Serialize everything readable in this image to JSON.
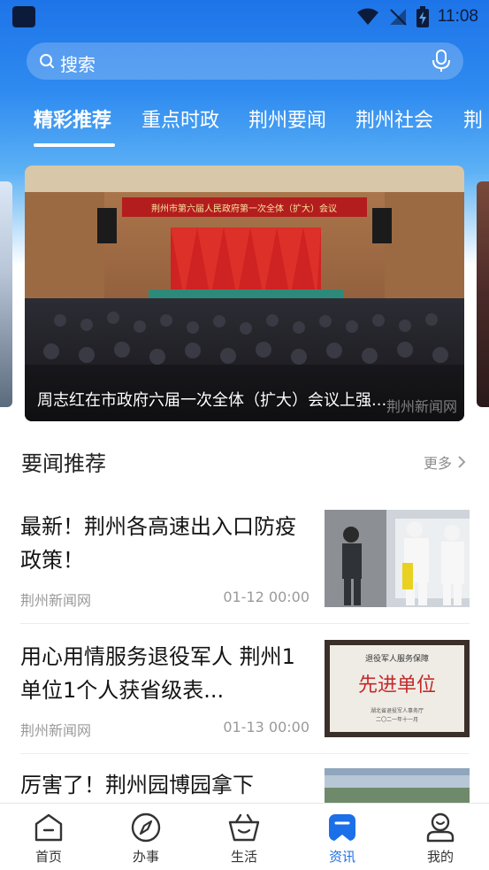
{
  "status_bar": {
    "time": "11:08"
  },
  "search": {
    "placeholder": "搜索"
  },
  "tabs": [
    {
      "label": "精彩推荐",
      "active": true
    },
    {
      "label": "重点时政"
    },
    {
      "label": "荆州要闻"
    },
    {
      "label": "荆州社会"
    },
    {
      "label": "荆"
    }
  ],
  "banner": {
    "headline": "荆州市第六届人民政府第一次全体（扩大）会议",
    "caption": "周志红在市政府六届一次全体（扩大）会议上强...",
    "watermark": "荆州新闻网"
  },
  "section": {
    "title": "要闻推荐",
    "more": "更多"
  },
  "news": [
    {
      "title": "最新！荆州各高速出入口防疫政策！",
      "source": "荆州新闻网",
      "date": "01-12 00:00"
    },
    {
      "title": "用心用情服务退役军人 荆州1单位1个人获省级表...",
      "source": "荆州新闻网",
      "date": "01-13 00:00",
      "thumb_text": {
        "header": "退役军人服务保障",
        "main": "先进单位",
        "footer1": "湖北省退役军人事务厅",
        "footer2": "二〇二一年十一月"
      }
    },
    {
      "title": "厉害了！荆州园博园拿下"
    }
  ],
  "bottom_nav": [
    {
      "label": "首页",
      "icon": "home-icon"
    },
    {
      "label": "办事",
      "icon": "compass-icon"
    },
    {
      "label": "生活",
      "icon": "basket-icon"
    },
    {
      "label": "资讯",
      "icon": "news-icon",
      "active": true
    },
    {
      "label": "我的",
      "icon": "profile-icon"
    }
  ],
  "colors": {
    "accent": "#1b6fe8",
    "header_top": "#1d74e8",
    "text_primary": "#141414",
    "text_secondary": "#9a9a9a"
  }
}
